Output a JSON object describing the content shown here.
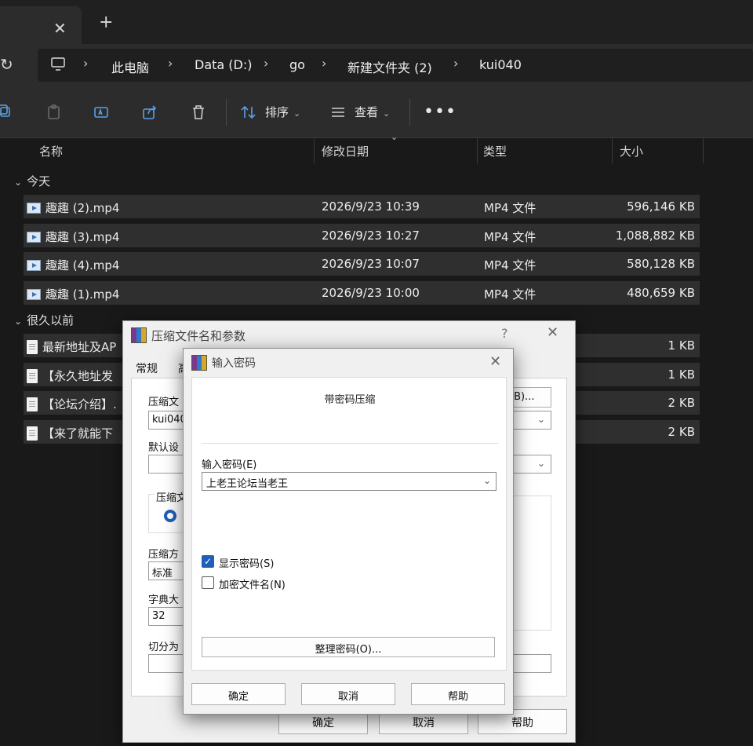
{
  "tabbar": {
    "close_glyph": "✕",
    "new_tab_glyph": "+"
  },
  "address": {
    "refresh_glyph": "↻",
    "crumbs": [
      "此电脑",
      "Data (D:)",
      "go",
      "新建文件夹 (2)",
      "kui040"
    ],
    "separator": "›"
  },
  "toolbar": {
    "sort_label": "排序",
    "view_label": "查看",
    "more_glyph": "•••",
    "caret": "⌄",
    "icons": [
      "copy-icon",
      "paste-icon",
      "rename-icon",
      "share-icon",
      "delete-icon",
      "sort-icon",
      "view-icon"
    ]
  },
  "columns": {
    "name": "名称",
    "modified": "修改日期",
    "type": "类型",
    "size": "大小",
    "sort_glyph": "⌄"
  },
  "groups": {
    "today": "今天",
    "long_ago": "很久以前",
    "chevron": "⌄"
  },
  "files_today": [
    {
      "name": "趣趣 (2).mp4",
      "date": "2026/9/23 10:39",
      "type": "MP4 文件",
      "size": "596,146 KB"
    },
    {
      "name": "趣趣 (3).mp4",
      "date": "2026/9/23 10:27",
      "type": "MP4 文件",
      "size": "1,088,882 KB"
    },
    {
      "name": "趣趣 (4).mp4",
      "date": "2026/9/23 10:07",
      "type": "MP4 文件",
      "size": "580,128 KB"
    },
    {
      "name": "趣趣 (1).mp4",
      "date": "2026/9/23 10:00",
      "type": "MP4 文件",
      "size": "480,659 KB"
    }
  ],
  "files_old": [
    {
      "name": "最新地址及AP",
      "size": "1 KB"
    },
    {
      "name": "【永久地址发",
      "size": "1 KB"
    },
    {
      "name": "【论坛介绍】.",
      "size": "2 KB"
    },
    {
      "name": "【来了就能下",
      "size": "2 KB"
    }
  ],
  "archive_dialog": {
    "title": "压缩文件名和参数",
    "help_glyph": "?",
    "close_glyph": "✕",
    "tab_general": "常规",
    "tab_advanced": "高",
    "label_archive_name": "压缩文",
    "archive_name_value": "kui040",
    "browse_label": "(B)...",
    "label_profile": "默认设",
    "group_format": "压缩文",
    "label_method": "压缩方",
    "method_value": "标准",
    "label_dict": "字典大",
    "dict_value": "32",
    "label_split": "切分为",
    "ok": "确定",
    "cancel": "取消",
    "help": "帮助"
  },
  "password_dialog": {
    "title": "输入密码",
    "close_glyph": "✕",
    "caption": "带密码压缩",
    "password_label": "输入密码(E)",
    "password_value": "上老王论坛当老王",
    "show_password": "显示密码(S)",
    "show_password_checked": true,
    "encrypt_names": "加密文件名(N)",
    "encrypt_names_checked": false,
    "organize_button": "整理密码(O)...",
    "ok": "确定",
    "cancel": "取消",
    "help": "帮助",
    "check_glyph": "✓"
  }
}
